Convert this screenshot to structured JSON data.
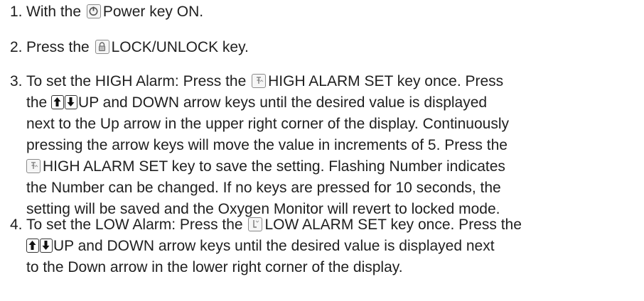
{
  "steps": [
    {
      "number": "1.",
      "lines": [
        {
          "a": "With the",
          "icon": "power-key-icon",
          "b": "Power key ON."
        }
      ]
    },
    {
      "number": "2.",
      "lines": [
        {
          "a": "Press the",
          "icon": "lock-key-icon",
          "b": "LOCK/UNLOCK key."
        }
      ]
    },
    {
      "number": "3.",
      "lines": [
        "To set the HIGH Alarm: Press the",
        "HIGH ALARM SET key once. Press",
        "the",
        "UP and DOWN arrow keys until the desired value is displayed",
        "next to the Up arrow in the upper right corner of the display. Continuously",
        "pressing the arrow keys will move the value in increments of 5. Press the",
        "HIGH ALARM SET key to save the setting. Flashing Number indicates",
        "the Number can be changed. If no keys are pressed for 10 seconds, the",
        "setting will be saved and the Oxygen Monitor will revert to locked mode."
      ]
    },
    {
      "number": "4.",
      "lines": [
        "To set the LOW Alarm: Press the",
        "LOW ALARM SET key once. Press the",
        "UP and DOWN arrow keys until the desired value is displayed next",
        "to the Down arrow in the lower right corner of the display."
      ]
    }
  ],
  "icons": {
    "power": "power-key-icon",
    "lock": "lock-key-icon",
    "high_alarm": "high-alarm-set-key-icon",
    "low_alarm": "low-alarm-set-key-icon",
    "up": "up-arrow-key-icon",
    "down": "down-arrow-key-icon"
  }
}
